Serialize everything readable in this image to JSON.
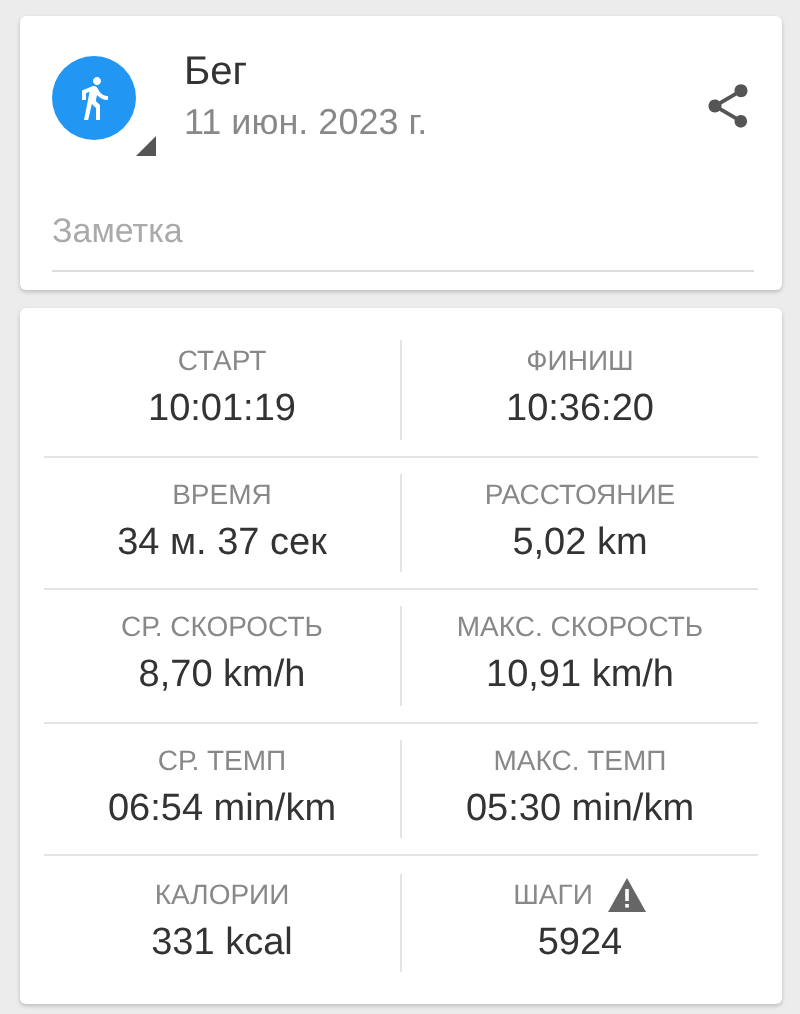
{
  "activity": {
    "title": "Бег",
    "date": "11 июн. 2023 г.",
    "note": {
      "placeholder": "Заметка"
    }
  },
  "stats": [
    {
      "label": "СТАРТ",
      "value": "10:01:19",
      "warning": false
    },
    {
      "label": "ФИНИШ",
      "value": "10:36:20",
      "warning": false
    },
    {
      "label": "ВРЕМЯ",
      "value": "34 м. 37 сек",
      "warning": false
    },
    {
      "label": "РАССТОЯНИЕ",
      "value": "5,02 km",
      "warning": false
    },
    {
      "label": "СР. СКОРОСТЬ",
      "value": "8,70 km/h",
      "warning": false
    },
    {
      "label": "МАКС. СКОРОСТЬ",
      "value": "10,91 km/h",
      "warning": false
    },
    {
      "label": "СР. ТЕМП",
      "value": "06:54 min/km",
      "warning": false
    },
    {
      "label": "МАКС. ТЕМП",
      "value": "05:30 min/km",
      "warning": false
    },
    {
      "label": "КАЛОРИИ",
      "value": "331 kcal",
      "warning": false
    },
    {
      "label": "ШАГИ",
      "value": "5924",
      "warning": true
    }
  ]
}
